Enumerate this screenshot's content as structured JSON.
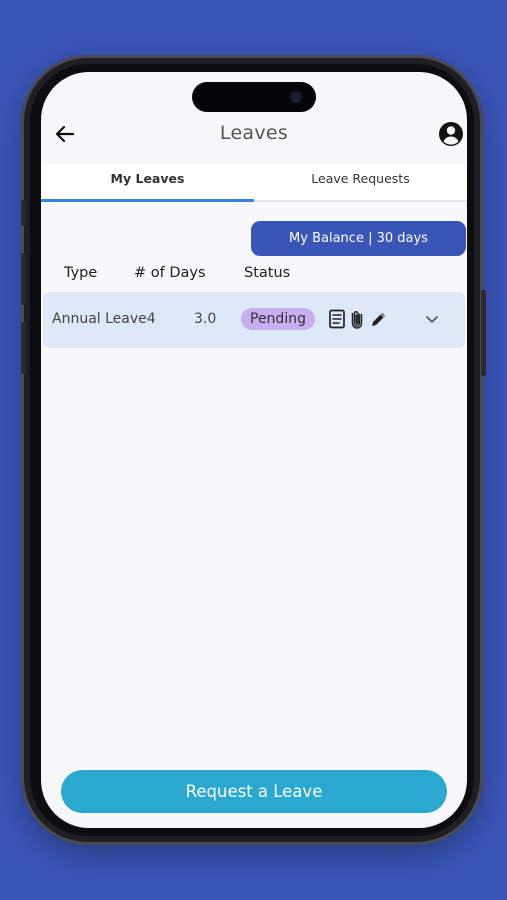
{
  "header": {
    "title": "Leaves",
    "back_icon": "arrow-left-icon",
    "profile_icon": "account-circle-icon"
  },
  "tabs": [
    {
      "label": "My Leaves",
      "active": true
    },
    {
      "label": "Leave Requests",
      "active": false
    }
  ],
  "balance": {
    "label": "My Balance | 30 days"
  },
  "table": {
    "columns": [
      "Type",
      "# of Days",
      "Status"
    ],
    "rows": [
      {
        "type": "Annual Leave4",
        "days": "3.0",
        "status": "Pending",
        "actions": [
          "document-icon",
          "paperclip-icon",
          "pencil-icon"
        ],
        "expand_icon": "chevron-down-icon"
      }
    ]
  },
  "footer": {
    "request_label": "Request a Leave"
  },
  "colors": {
    "background": "#3a55b8",
    "primary": "#3a55b8",
    "accent_button": "#2aa8cf",
    "tab_indicator": "#3b83d9",
    "row_background": "#dde9f8",
    "status_pending": "#c9aef2"
  }
}
